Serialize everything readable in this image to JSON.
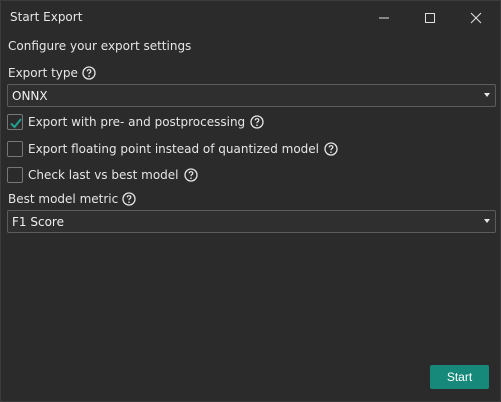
{
  "window": {
    "title": "Start Export"
  },
  "dialog": {
    "heading": "Configure your export settings",
    "export_type": {
      "label": "Export type",
      "selected": "ONNX"
    },
    "checkboxes": [
      {
        "label": "Export with pre- and postprocessing",
        "checked": true
      },
      {
        "label": "Export floating point instead of quantized model",
        "checked": false
      },
      {
        "label": "Check last vs best model",
        "checked": false
      }
    ],
    "best_model_metric": {
      "label": "Best model metric",
      "selected": "F1 Score"
    },
    "start_label": "Start"
  },
  "colors": {
    "accent": "#16897a",
    "background": "#2b2b2b",
    "checkmark": "#20a08e"
  },
  "icons": {
    "help": "question-circle-icon",
    "check": "checkmark-icon",
    "dropdown": "chevron-down-icon"
  }
}
